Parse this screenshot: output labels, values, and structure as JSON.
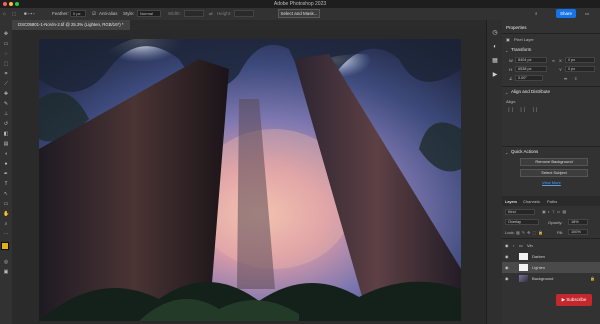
{
  "app": {
    "title": "Adobe Photoshop 2023"
  },
  "options": {
    "feather_label": "Feather:",
    "feather_value": "0 px",
    "antialias_label": "Anti-alias",
    "style_label": "Style:",
    "style_value": "Normal",
    "width_label": "Width:",
    "height_label": "Height:",
    "select_mask": "Select and Mask...",
    "share": "Share"
  },
  "document": {
    "tab": "DSC05801-1-NoVin-2.tif @ 25.3% (Lighten, RGB/16*) *"
  },
  "properties": {
    "title": "Properties",
    "layer_kind": "Pixel Layer",
    "transform": {
      "header": "Transform",
      "w_label": "W",
      "h_label": "H",
      "w": "8404 px",
      "h": "6538 px",
      "x_label": "X",
      "y_label": "Y",
      "x": "0 px",
      "y": "0 px",
      "angle": "0.00°"
    },
    "align": {
      "header": "Align and Distribute",
      "label": "Align:"
    },
    "quick_actions": {
      "header": "Quick Actions",
      "remove_bg": "Remove Background",
      "select_subject": "Select Subject",
      "view_more": "View More"
    }
  },
  "layers_panel": {
    "tabs": [
      "Layers",
      "Channels",
      "Paths"
    ],
    "kind": "Kind",
    "blend_mode": "Overlay",
    "opacity_label": "Opacity:",
    "opacity": "18%",
    "lock_label": "Lock:",
    "fill_label": "Fill:",
    "fill": "100%",
    "layers": [
      {
        "name": "Vin"
      },
      {
        "name": "Darken"
      },
      {
        "name": "Lighten"
      },
      {
        "name": "Background"
      }
    ]
  },
  "overlay": {
    "subscribe": "Subscribe"
  },
  "colors": {
    "accent": "#1473e6",
    "subscribe": "#c4282c",
    "foreground_swatch": "#e0b21a"
  }
}
